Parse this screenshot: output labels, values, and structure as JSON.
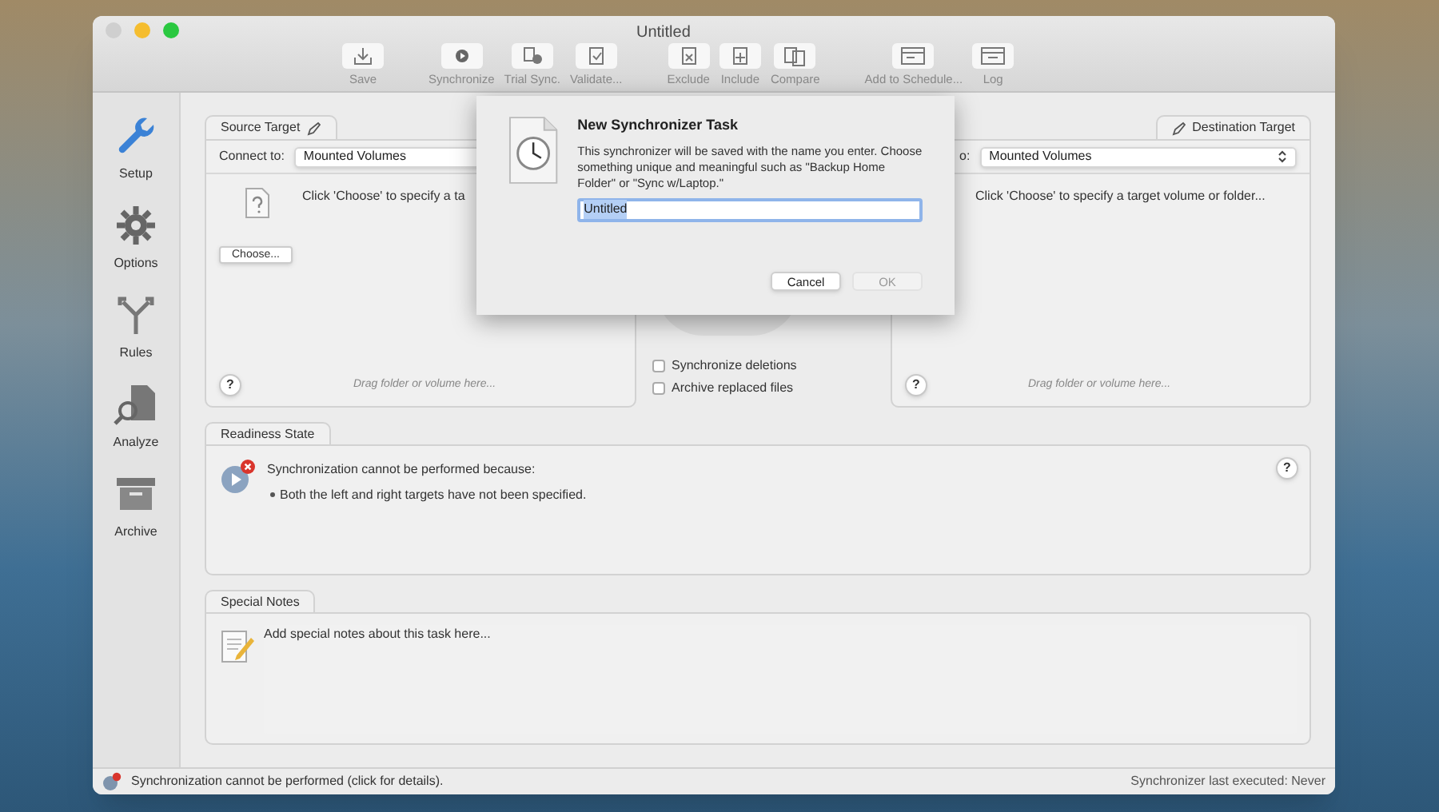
{
  "window": {
    "title": "Untitled"
  },
  "toolbar": {
    "groups": [
      [
        {
          "label": "Save"
        }
      ],
      [
        {
          "label": "Synchronize"
        },
        {
          "label": "Trial Sync."
        },
        {
          "label": "Validate..."
        }
      ],
      [
        {
          "label": "Exclude"
        },
        {
          "label": "Include"
        },
        {
          "label": "Compare"
        }
      ],
      [
        {
          "label": "Add to Schedule..."
        },
        {
          "label": "Log"
        }
      ]
    ]
  },
  "sidebar": {
    "items": [
      {
        "label": "Setup"
      },
      {
        "label": "Options"
      },
      {
        "label": "Rules"
      },
      {
        "label": "Analyze"
      },
      {
        "label": "Archive"
      }
    ]
  },
  "source_panel": {
    "tab": "Source Target",
    "connect_label": "Connect to:",
    "connect_value": "Mounted Volumes",
    "prompt": "Click 'Choose' to specify a ta",
    "choose_button": "Choose...",
    "help": "?",
    "drag_hint": "Drag folder or volume here..."
  },
  "options": [
    {
      "label": "Synchronize deletions",
      "checked": false
    },
    {
      "label": "Archive replaced files",
      "checked": false
    }
  ],
  "destination_panel": {
    "tab": "Destination Target",
    "connect_label": "o:",
    "connect_value": "Mounted Volumes",
    "prompt": "Click 'Choose' to specify a target volume or folder...",
    "help": "?",
    "drag_hint": "Drag folder or volume here..."
  },
  "readiness": {
    "tab": "Readiness State",
    "message": "Synchronization cannot be performed because:",
    "reasons": [
      "Both the left and right targets have not been specified."
    ],
    "help": "?"
  },
  "notes": {
    "tab": "Special Notes",
    "placeholder": "Add special notes about this task here..."
  },
  "status_bar": {
    "message": "Synchronization cannot be performed (click for details).",
    "last_run": "Synchronizer last executed: Never"
  },
  "dialog": {
    "title": "New Synchronizer Task",
    "message": "This synchronizer will be saved with the name you enter. Choose something unique and meaningful such as \"Backup Home Folder\" or \"Sync w/Laptop.\"",
    "name_value": "Untitled",
    "buttons": [
      {
        "label": "Cancel",
        "disabled": false
      },
      {
        "label": "OK",
        "disabled": true
      }
    ]
  }
}
